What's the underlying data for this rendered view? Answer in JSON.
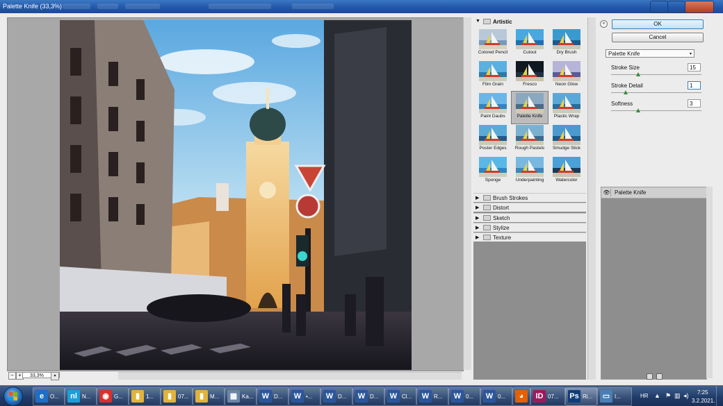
{
  "window": {
    "title": "Palette Knife (33,3%)"
  },
  "preview": {
    "zoom": "33,3%",
    "minus": "−",
    "plus": "+",
    "dropdown_arrow": "▾"
  },
  "gallery": {
    "open_category": "Artistic",
    "filters": [
      {
        "label": "Colored Pencil",
        "style": "pencil"
      },
      {
        "label": "Cutout",
        "style": "cutout"
      },
      {
        "label": "Dry Brush",
        "style": "drybrush"
      },
      {
        "label": "Film Grain",
        "style": "grain"
      },
      {
        "label": "Fresco",
        "style": "fresco"
      },
      {
        "label": "Neon Glow",
        "style": "neon"
      },
      {
        "label": "Paint Daubs",
        "style": "daubs"
      },
      {
        "label": "Palette Knife",
        "style": "knife",
        "selected": true
      },
      {
        "label": "Plastic Wrap",
        "style": "plastic"
      },
      {
        "label": "Poster Edges",
        "style": "poster"
      },
      {
        "label": "Rough Pastels",
        "style": "pastels"
      },
      {
        "label": "Smudge Stick",
        "style": "smudge"
      },
      {
        "label": "Sponge",
        "style": "sponge"
      },
      {
        "label": "Underpainting",
        "style": "under"
      },
      {
        "label": "Watercolor",
        "style": "water"
      }
    ],
    "categories": [
      "Brush Strokes",
      "Distort",
      "Sketch",
      "Stylize",
      "Texture"
    ]
  },
  "buttons": {
    "ok": "OK",
    "cancel": "Cancel",
    "collapse": "«"
  },
  "filter_select": {
    "value": "Palette Knife",
    "arrow": "▾"
  },
  "params": [
    {
      "label": "Stroke Size",
      "value": "15",
      "fraction": 0.3
    },
    {
      "label": "Stroke Detail",
      "value": "1",
      "fraction": 0.16
    },
    {
      "label": "Softness",
      "value": "3",
      "fraction": 0.3
    }
  ],
  "layers": [
    {
      "name": "Palette Knife",
      "visible": true
    }
  ],
  "taskbar": {
    "items": [
      {
        "label": "O...",
        "icon": "ie-icon",
        "color": "#1e6fc4",
        "glyph": "e"
      },
      {
        "label": "N...",
        "icon": "news-icon",
        "color": "#1aa0d8",
        "glyph": "nl"
      },
      {
        "label": "G...",
        "icon": "chrome-icon",
        "color": "#d9302c",
        "glyph": "◉"
      },
      {
        "label": "1...",
        "icon": "folder-icon",
        "color": "#e0b43a",
        "glyph": "▮"
      },
      {
        "label": "07...",
        "icon": "folder-icon",
        "color": "#e0b43a",
        "glyph": "▮"
      },
      {
        "label": "M...",
        "icon": "folder-icon",
        "color": "#e0b43a",
        "glyph": "▮"
      },
      {
        "label": "Ka...",
        "icon": "calculator-icon",
        "color": "#6c86a8",
        "glyph": "▦"
      },
      {
        "label": "D...",
        "icon": "word-icon",
        "color": "#2b579a",
        "glyph": "W"
      },
      {
        "label": "•...",
        "icon": "word-icon",
        "color": "#2b579a",
        "glyph": "W"
      },
      {
        "label": "D...",
        "icon": "word-icon",
        "color": "#2b579a",
        "glyph": "W"
      },
      {
        "label": "D...",
        "icon": "word-icon",
        "color": "#2b579a",
        "glyph": "W"
      },
      {
        "label": "Cl...",
        "icon": "word-icon",
        "color": "#2b579a",
        "glyph": "W"
      },
      {
        "label": "R...",
        "icon": "word-icon",
        "color": "#2b579a",
        "glyph": "W"
      },
      {
        "label": "0...",
        "icon": "word-icon",
        "color": "#2b579a",
        "glyph": "W"
      },
      {
        "label": "0...",
        "icon": "word-icon",
        "color": "#2b579a",
        "glyph": "W"
      },
      {
        "label": "",
        "icon": "firefox-icon",
        "color": "#e66000",
        "glyph": "◕"
      },
      {
        "label": "07...",
        "icon": "indesign-icon",
        "color": "#a0185a",
        "glyph": "ID"
      },
      {
        "label": "Ri...",
        "icon": "photoshop-icon",
        "color": "#0f3d7a",
        "glyph": "Ps",
        "active": true
      },
      {
        "label": "I...",
        "icon": "monitor-icon",
        "color": "#4a7fb5",
        "glyph": "▭"
      }
    ],
    "tray": {
      "language": "HR",
      "time": "7:25",
      "date": "3.2.2021."
    }
  }
}
